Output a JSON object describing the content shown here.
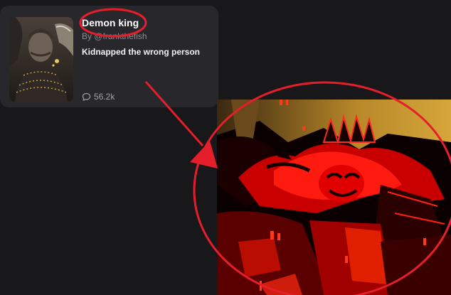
{
  "card": {
    "title": "Demon king",
    "author": "By @frankthefish",
    "description": "Kidnapped the wrong person",
    "chat_count": "56.2k",
    "stats_icon": "chat-bubble-icon"
  },
  "annotation": {
    "color": "#e41e2b"
  }
}
